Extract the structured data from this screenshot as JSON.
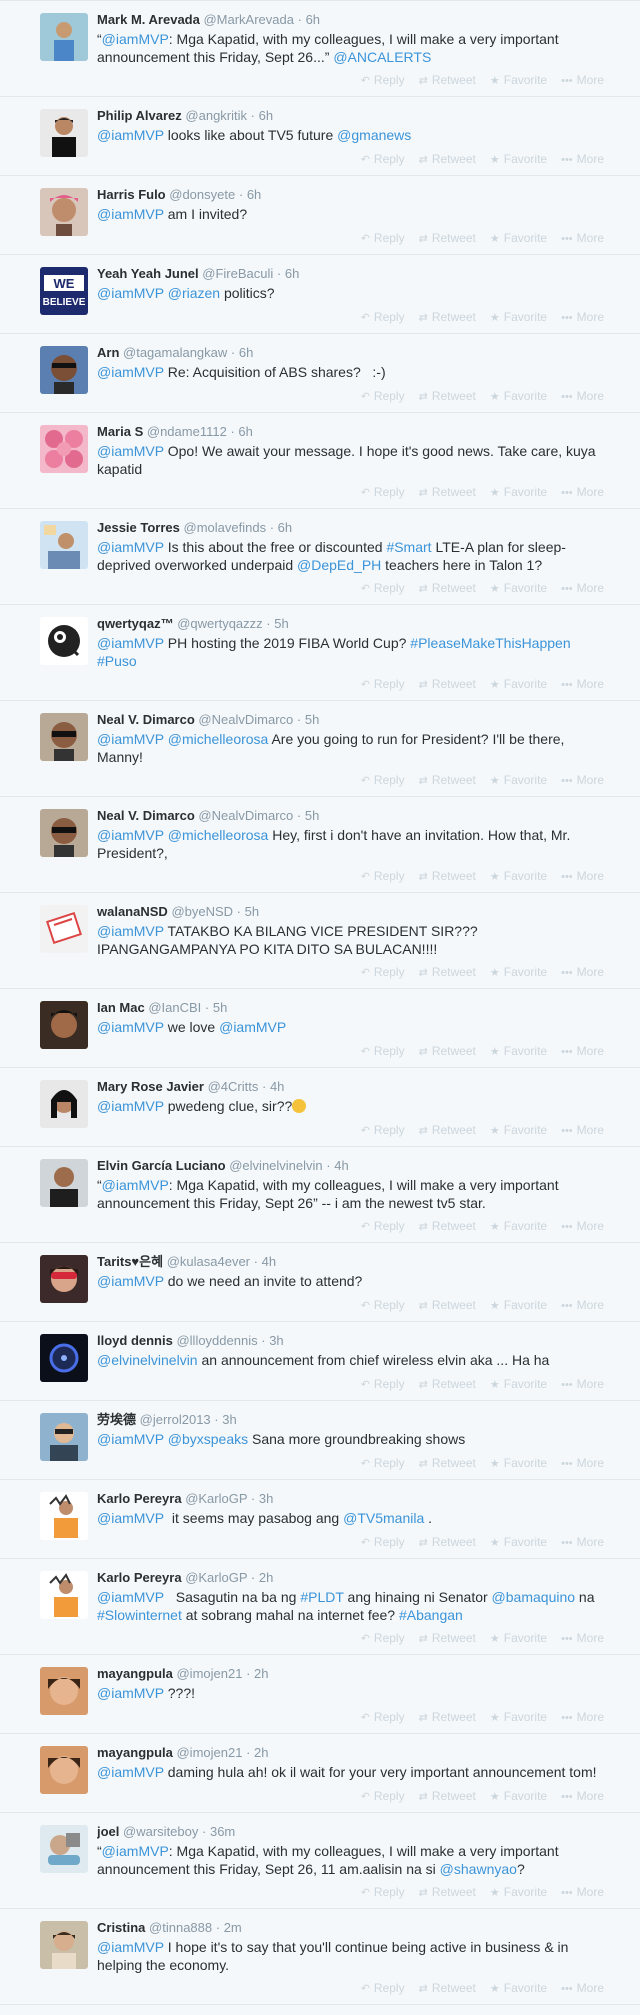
{
  "labels": {
    "reply": "Reply",
    "retweet": "Retweet",
    "favorite": "Favorite",
    "more": "More",
    "sep": "·"
  },
  "icons": {
    "reply": "reply-icon",
    "retweet": "retweet-icon",
    "favorite": "star-icon",
    "more": "more-dots-icon"
  },
  "colors": {
    "link": "#3b94d9",
    "name": "#292f33",
    "meta": "#8899a6",
    "action": "#ccd6dd",
    "background": "#f5f8fa"
  },
  "tweets": [
    {
      "name": "Mark M. Arevada",
      "handle": "@MarkArevada",
      "time": "6h",
      "text": [
        [
          "“"
        ],
        [
          "@iamMVP",
          1
        ],
        [
          ": Mga Kapatid, with my colleagues, I will make a very important announcement this Friday, Sept 26...” "
        ],
        [
          "@ANCALERTS",
          1
        ]
      ]
    },
    {
      "name": "Philip Alvarez",
      "handle": "@angkritik",
      "time": "6h",
      "text": [
        [
          "@iamMVP",
          1
        ],
        [
          " looks like about TV5 future "
        ],
        [
          "@gmanews",
          1
        ]
      ]
    },
    {
      "name": "Harris Fulo",
      "handle": "@donsyete",
      "time": "6h",
      "text": [
        [
          "@iamMVP",
          1
        ],
        [
          " am I invited?"
        ]
      ]
    },
    {
      "name": "Yeah Yeah Junel",
      "handle": "@FireBaculi",
      "time": "6h",
      "text": [
        [
          "@iamMVP",
          1
        ],
        [
          " "
        ],
        [
          "@riazen",
          1
        ],
        [
          " politics?"
        ]
      ]
    },
    {
      "name": "Arn",
      "handle": "@tagamalangkaw",
      "time": "6h",
      "text": [
        [
          "@iamMVP",
          1
        ],
        [
          " Re: Acquisition of ABS shares?   :-)"
        ]
      ]
    },
    {
      "name": "Maria S",
      "handle": "@ndame1112",
      "time": "6h",
      "text": [
        [
          "@iamMVP",
          1
        ],
        [
          " Opo! We await your message. I hope it's good news. Take care, kuya kapatid"
        ]
      ]
    },
    {
      "name": "Jessie Torres",
      "handle": "@molavefinds",
      "time": "6h",
      "text": [
        [
          "@iamMVP",
          1
        ],
        [
          " Is this about the free or discounted "
        ],
        [
          "#Smart",
          1
        ],
        [
          " LTE-A plan for sleep-deprived overworked underpaid "
        ],
        [
          "@DepEd_PH",
          1
        ],
        [
          " teachers here in Talon 1?"
        ]
      ]
    },
    {
      "name": "qwertyqaz™",
      "handle": "@qwertyqazzz",
      "time": "5h",
      "text": [
        [
          "@iamMVP",
          1
        ],
        [
          " PH hosting the 2019 FIBA World Cup? "
        ],
        [
          "#PleaseMakeThisHappen",
          1
        ],
        [
          " "
        ],
        [
          "#Puso",
          1
        ]
      ]
    },
    {
      "name": "Neal V. Dimarco",
      "handle": "@NealvDimarco",
      "time": "5h",
      "text": [
        [
          "@iamMVP",
          1
        ],
        [
          " "
        ],
        [
          "@michelleorosa",
          1
        ],
        [
          " Are you going to run for President? I'll be there, Manny!"
        ]
      ]
    },
    {
      "name": "Neal V. Dimarco",
      "handle": "@NealvDimarco",
      "time": "5h",
      "text": [
        [
          "@iamMVP",
          1
        ],
        [
          " "
        ],
        [
          "@michelleorosa",
          1
        ],
        [
          " Hey, first i don't have an invitation. How that, Mr. President?,"
        ]
      ]
    },
    {
      "name": "walanaNSD",
      "handle": "@byeNSD",
      "time": "5h",
      "text": [
        [
          "@iamMVP",
          1
        ],
        [
          " TATAKBO KA BILANG VICE PRESIDENT SIR??? IPANGANGAMPANYA PO KITA DITO SA BULACAN!!!!"
        ]
      ]
    },
    {
      "name": "Ian Mac",
      "handle": "@IanCBI",
      "time": "5h",
      "text": [
        [
          "@iamMVP",
          1
        ],
        [
          " we love "
        ],
        [
          "@iamMVP",
          1
        ]
      ]
    },
    {
      "name": "Mary Rose Javier",
      "handle": "@4Critts",
      "time": "4h",
      "text": [
        [
          "@iamMVP",
          1
        ],
        [
          " pwedeng clue, sir??"
        ]
      ],
      "emoji": true
    },
    {
      "name": "Elvin García Luciano",
      "handle": "@elvinelvinelvin",
      "time": "4h",
      "text": [
        [
          "“"
        ],
        [
          "@iamMVP",
          1
        ],
        [
          ": Mga Kapatid, with my colleagues, I will make a very important announcement this Friday, Sept 26” -- i am the newest tv5 star."
        ]
      ]
    },
    {
      "name": "Tarits♥은혜",
      "handle": "@kulasa4ever",
      "time": "4h",
      "text": [
        [
          "@iamMVP",
          1
        ],
        [
          " do we need an invite to attend?"
        ]
      ]
    },
    {
      "name": "lloyd dennis",
      "handle": "@llloyddennis",
      "time": "3h",
      "text": [
        [
          "@elvinelvinelvin",
          1
        ],
        [
          " an announcement from chief wireless elvin aka ... Ha ha"
        ]
      ]
    },
    {
      "name": "劳埃德",
      "handle": "@jerrol2013",
      "time": "3h",
      "text": [
        [
          "@iamMVP",
          1
        ],
        [
          " "
        ],
        [
          "@byxspeaks",
          1
        ],
        [
          " Sana more groundbreaking shows"
        ]
      ]
    },
    {
      "name": "Karlo Pereyra",
      "handle": "@KarloGP",
      "time": "3h",
      "text": [
        [
          "@iamMVP",
          1
        ],
        [
          "  it seems may pasabog ang "
        ],
        [
          "@TV5manila",
          1
        ],
        [
          " ."
        ]
      ]
    },
    {
      "name": "Karlo Pereyra",
      "handle": "@KarloGP",
      "time": "2h",
      "text": [
        [
          "@iamMVP",
          1
        ],
        [
          "   Sasagutin na ba ng "
        ],
        [
          "#PLDT",
          1
        ],
        [
          " ang hinaing ni Senator "
        ],
        [
          "@bamaquino",
          1
        ],
        [
          " na "
        ],
        [
          "#Slowinternet",
          1
        ],
        [
          " at sobrang mahal na internet fee? "
        ],
        [
          "#Abangan",
          1
        ]
      ]
    },
    {
      "name": "mayangpula",
      "handle": "@imojen21",
      "time": "2h",
      "text": [
        [
          "@iamMVP",
          1
        ],
        [
          " ???!"
        ]
      ]
    },
    {
      "name": "mayangpula",
      "handle": "@imojen21",
      "time": "2h",
      "text": [
        [
          "@iamMVP",
          1
        ],
        [
          " daming hula ah! ok il wait for your very important announcement tom!"
        ]
      ]
    },
    {
      "name": "joel",
      "handle": "@warsiteboy",
      "time": "36m",
      "text": [
        [
          "“"
        ],
        [
          "@iamMVP",
          1
        ],
        [
          ": Mga Kapatid, with my colleagues, I will make a very important announcement this Friday, Sept 26, 11 am.aalisin na si "
        ],
        [
          "@shawnyao",
          1
        ],
        [
          "?"
        ]
      ]
    },
    {
      "name": "Cristina",
      "handle": "@tinna888",
      "time": "2m",
      "text": [
        [
          "@iamMVP",
          1
        ],
        [
          " I hope it's to say that you'll continue being active in business & in helping the economy."
        ]
      ]
    }
  ]
}
